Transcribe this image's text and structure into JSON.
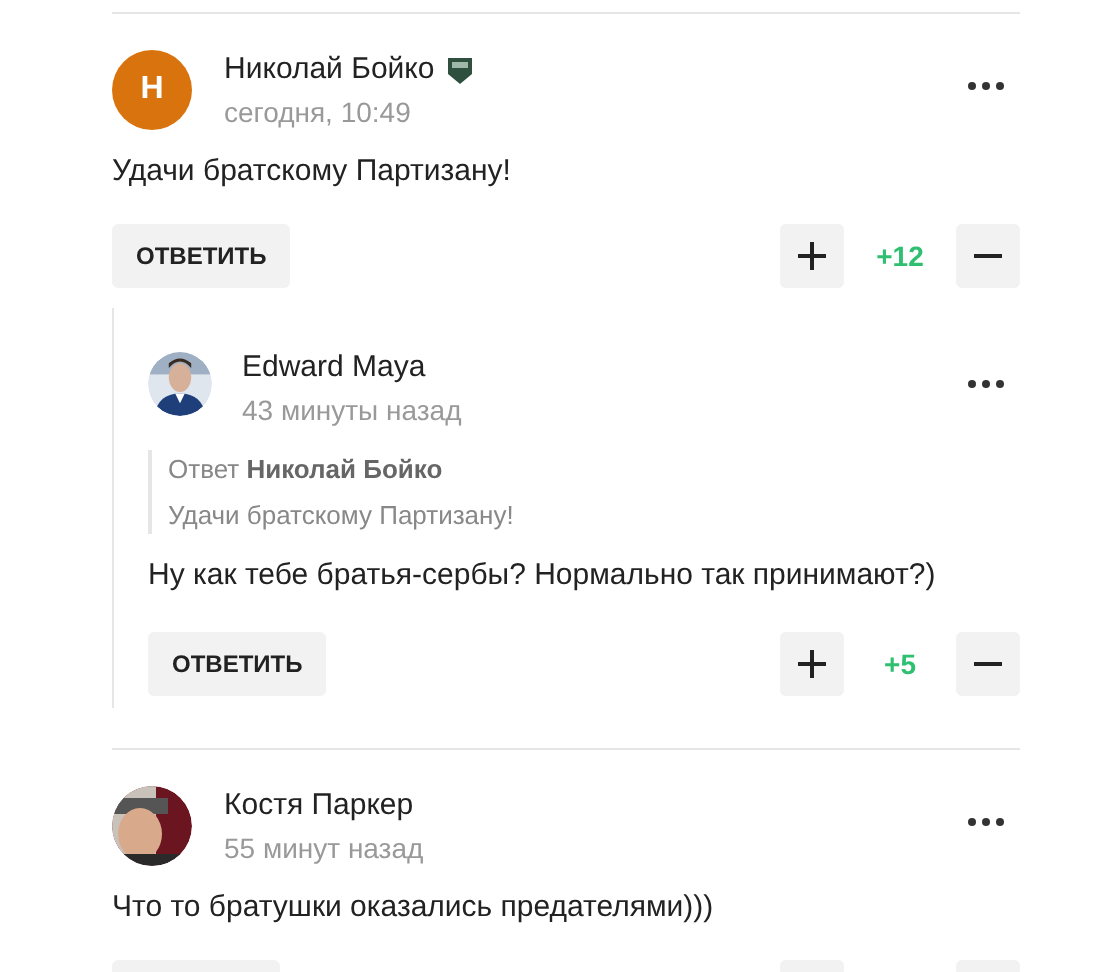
{
  "comments": [
    {
      "avatar": {
        "kind": "letter",
        "letter": "Н",
        "color": "#d9730d"
      },
      "author": "Николай Бойко",
      "badge": true,
      "time": "сегодня, 10:49",
      "text": "Удачи братскому Партизану!",
      "reply_label": "ОТВЕТИТЬ",
      "score": "+12",
      "replies": [
        {
          "author": "Edward Maya",
          "badge": false,
          "time": "43 минуты назад",
          "quote": {
            "prefix": "Ответ",
            "author": "Николай Бойко",
            "text": "Удачи братскому Партизану!"
          },
          "text": "Ну как тебе братья-сербы? Нормально так принимают?)",
          "reply_label": "ОТВЕТИТЬ",
          "score": "+5"
        }
      ]
    },
    {
      "author": "Костя Паркер",
      "badge": false,
      "time": "55 минут назад",
      "text": "Что то братушки оказались предателями)))"
    }
  ]
}
